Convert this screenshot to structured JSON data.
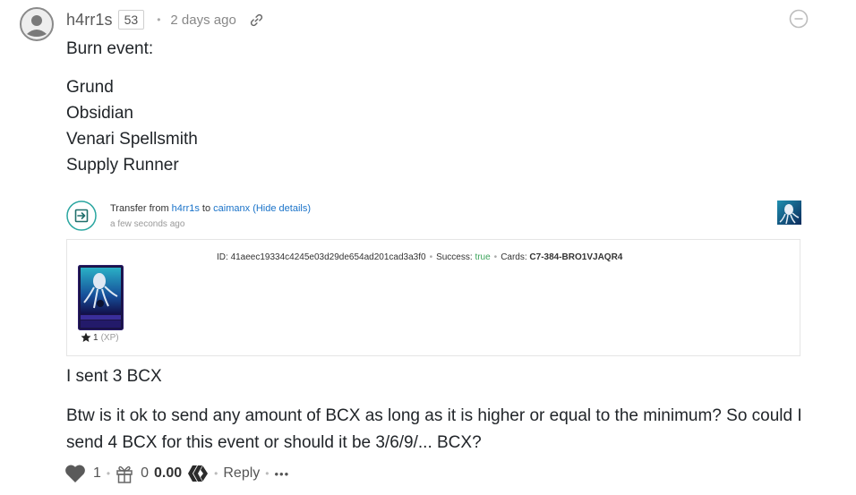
{
  "comment": {
    "author": "h4rr1s",
    "reputation": "53",
    "time": "2 days ago",
    "lines": {
      "title": "Burn event:",
      "item1": "Grund",
      "item2": "Obsidian",
      "item3": "Venari Spellsmith",
      "item4": "Supply Runner",
      "sent": "I sent 3 BCX",
      "q1": "Btw is it ok to send any amount of BCX as long as it is higher or equal to the minimum? So could I",
      "q2": "send 4 BCX for this event or should it be 3/6/9/... BCX?"
    }
  },
  "transfer": {
    "prefix": "Transfer from ",
    "from": "h4rr1s",
    "to_word": " to ",
    "to": "caimanx",
    "details": "(Hide details)",
    "time": "a few seconds ago",
    "id_label": "ID: ",
    "id": "41aeec19334c4245e03d29de654ad201cad3a3f0",
    "success_label": "Success: ",
    "success": "true",
    "cards_label": "Cards: ",
    "cards": "C7-384-BRO1VJAQR4",
    "card_level": "1",
    "card_xp": "(XP)"
  },
  "footer": {
    "likes": "1",
    "gifts": "0",
    "payout": "0.00",
    "reply": "Reply",
    "more": "•••"
  },
  "icons": [
    "avatar",
    "link-icon",
    "collapse-icon",
    "transfer-icon",
    "card-thumbnail",
    "card-image",
    "star-icon",
    "heart-icon",
    "gift-icon",
    "hive-icon",
    "more-icon"
  ],
  "colors": {
    "link": "#1a73c9",
    "success": "#3aa35a",
    "accent_teal": "#2aa6a0"
  }
}
